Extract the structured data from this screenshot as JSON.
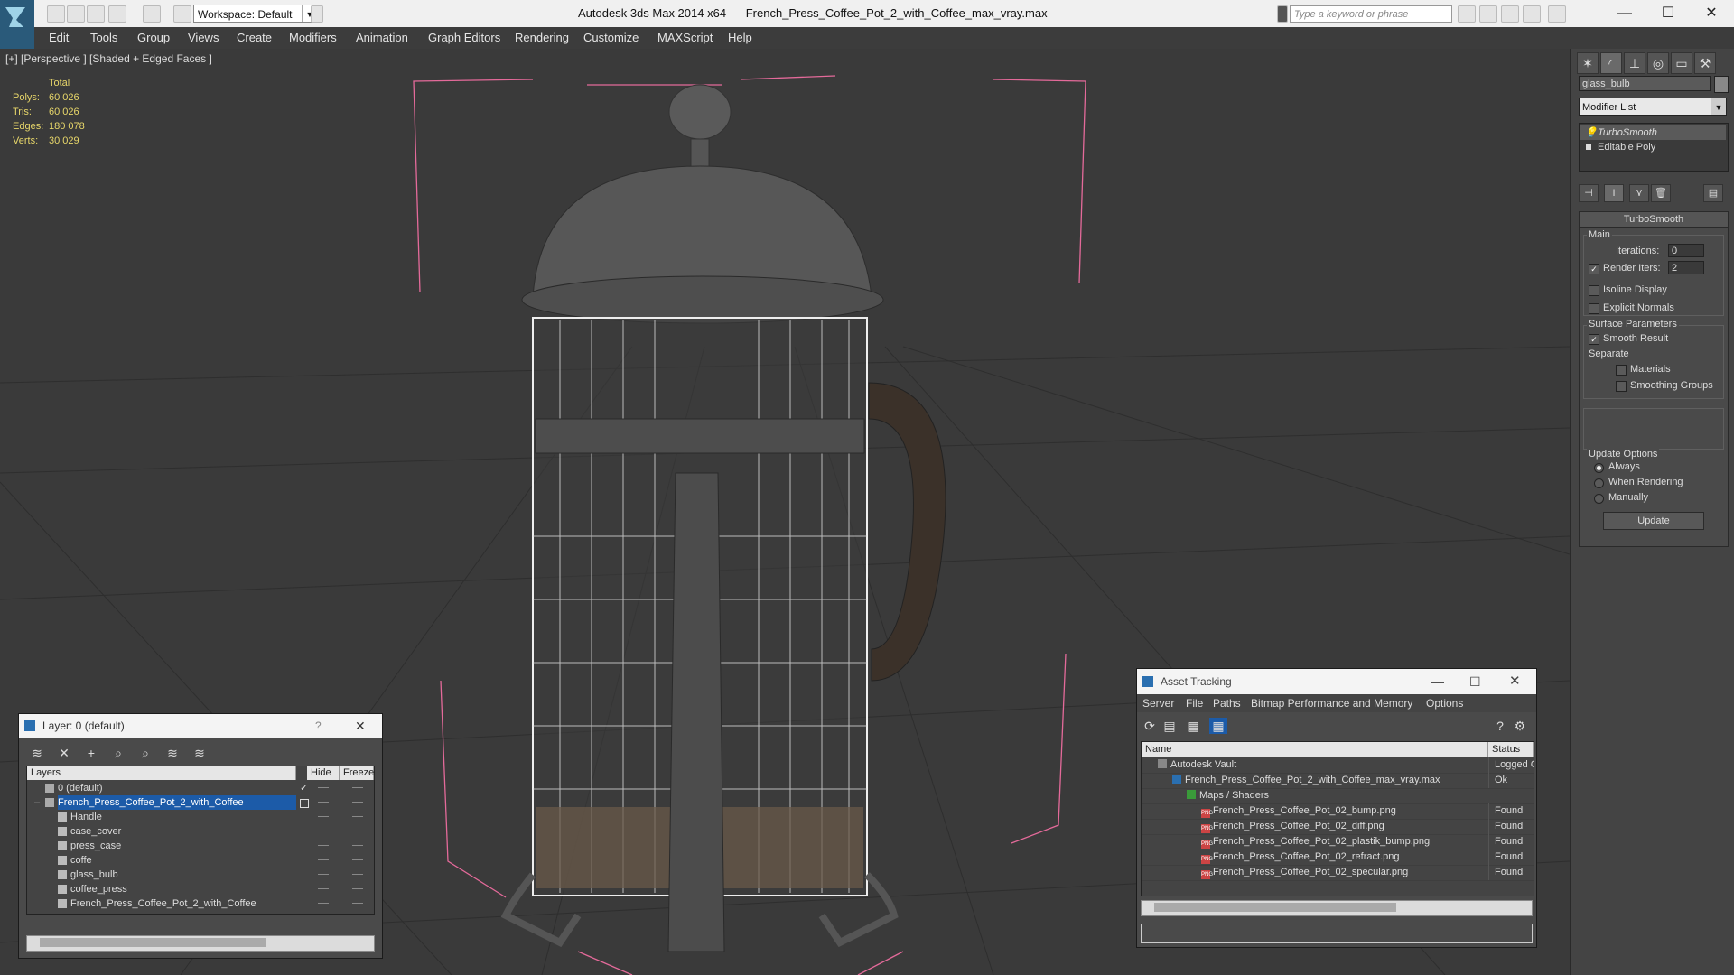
{
  "titlebar": {
    "app": "Autodesk 3ds Max 2014 x64",
    "file": "French_Press_Coffee_Pot_2_with_Coffee_max_vray.max",
    "workspace": "Workspace: Default",
    "search_placeholder": "Type a keyword or phrase"
  },
  "menu": [
    "Edit",
    "Tools",
    "Group",
    "Views",
    "Create",
    "Modifiers",
    "Animation",
    "Graph Editors",
    "Rendering",
    "Customize",
    "MAXScript",
    "Help"
  ],
  "viewport": {
    "label": "[+] [Perspective ] [Shaded + Edged Faces ]",
    "stats": {
      "header": "Total",
      "rows": [
        {
          "k": "Polys:",
          "v": "60 026"
        },
        {
          "k": "Tris:",
          "v": "60 026"
        },
        {
          "k": "Edges:",
          "v": "180 078"
        },
        {
          "k": "Verts:",
          "v": "30 029"
        }
      ]
    }
  },
  "command_panel": {
    "object_name": "glass_bulb",
    "modifier_list": "Modifier List",
    "stack": [
      "TurboSmooth",
      "Editable Poly"
    ],
    "rollout_title": "TurboSmooth",
    "main_label": "Main",
    "iterations_label": "Iterations:",
    "iterations_value": "0",
    "render_iters_label": "Render Iters:",
    "render_iters_value": "2",
    "isoline_display": "Isoline Display",
    "explicit_normals": "Explicit Normals",
    "surface_parameters": "Surface Parameters",
    "smooth_result": "Smooth Result",
    "separate": "Separate",
    "materials": "Materials",
    "smoothing_groups": "Smoothing Groups",
    "update_options": "Update Options",
    "always": "Always",
    "when_rendering": "When Rendering",
    "manually": "Manually",
    "update_button": "Update"
  },
  "layer_dialog": {
    "title": "Layer: 0 (default)",
    "help": "?",
    "columns": [
      "Layers",
      "Hide",
      "Freeze"
    ],
    "rows": [
      {
        "name": "0 (default)",
        "level": 1
      },
      {
        "name": "French_Press_Coffee_Pot_2_with_Coffee",
        "level": 1
      },
      {
        "name": "Handle",
        "level": 2
      },
      {
        "name": "case_cover",
        "level": 2
      },
      {
        "name": "press_case",
        "level": 2
      },
      {
        "name": "coffe",
        "level": 2
      },
      {
        "name": "glass_bulb",
        "level": 2
      },
      {
        "name": "coffee_press",
        "level": 2
      },
      {
        "name": "French_Press_Coffee_Pot_2_with_Coffee",
        "level": 2
      }
    ]
  },
  "asset_dialog": {
    "title": "Asset Tracking",
    "menu": [
      "Server",
      "File",
      "Paths",
      "Bitmap Performance and Memory",
      "Options"
    ],
    "columns": [
      "Name",
      "Status"
    ],
    "rows": [
      {
        "name": "Autodesk Vault",
        "status": "Logged C"
      },
      {
        "name": "French_Press_Coffee_Pot_2_with_Coffee_max_vray.max",
        "status": "Ok"
      },
      {
        "name": "Maps / Shaders",
        "status": ""
      },
      {
        "name": "French_Press_Coffee_Pot_02_bump.png",
        "status": "Found"
      },
      {
        "name": "French_Press_Coffee_Pot_02_diff.png",
        "status": "Found"
      },
      {
        "name": "French_Press_Coffee_Pot_02_plastik_bump.png",
        "status": "Found"
      },
      {
        "name": "French_Press_Coffee_Pot_02_refract.png",
        "status": "Found"
      },
      {
        "name": "French_Press_Coffee_Pot_02_specular.png",
        "status": "Found"
      }
    ],
    "png_badge": "PNG"
  }
}
